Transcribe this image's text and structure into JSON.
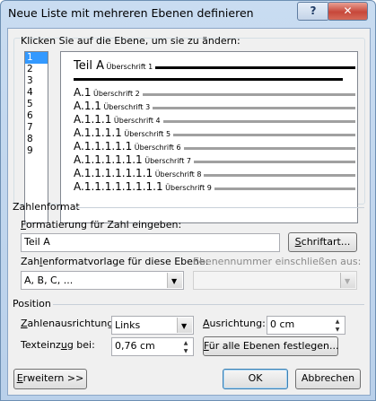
{
  "window": {
    "title": "Neue Liste mit mehreren Ebenen definieren",
    "help_label": "?",
    "close_label": "✕"
  },
  "level_section": {
    "instruction": "Klicken Sie auf die Ebene, um sie zu ändern:",
    "levels": [
      "1",
      "2",
      "3",
      "4",
      "5",
      "6",
      "7",
      "8",
      "9"
    ],
    "selected_level": "1"
  },
  "preview": {
    "rows": [
      {
        "num": "Teil A",
        "caption": "Überschrift 1"
      },
      {
        "num": "A.1",
        "caption": "Überschrift 2"
      },
      {
        "num": "A.1.1",
        "caption": "Überschrift 3"
      },
      {
        "num": "A.1.1.1",
        "caption": "Überschrift 4"
      },
      {
        "num": "A.1.1.1.1",
        "caption": "Überschrift 5"
      },
      {
        "num": "A.1.1.1.1.1",
        "caption": "Überschrift 6"
      },
      {
        "num": "A.1.1.1.1.1.1",
        "caption": "Überschrift 7"
      },
      {
        "num": "A.1.1.1.1.1.1.1",
        "caption": "Überschrift 8"
      },
      {
        "num": "A.1.1.1.1.1.1.1.1",
        "caption": "Überschrift 9"
      }
    ]
  },
  "zahlenformat": {
    "group_label": "Zahlenformat",
    "format_label": "Formatierung für Zahl eingeben:",
    "format_value": "Teil A",
    "font_button": "Schriftart...",
    "style_label": "Zahlenformatvorlage für diese Ebene:",
    "style_value": "A, B, C, ...",
    "include_label": "Ebenennummer einschließen aus:",
    "include_value": ""
  },
  "position": {
    "group_label": "Position",
    "align_label": "Zahlenausrichtung:",
    "align_value": "Links",
    "ausrichtung_label": "Ausrichtung:",
    "ausrichtung_value": "0 cm",
    "indent_label": "Texteinzug bei:",
    "indent_value": "0,76 cm",
    "all_levels_button": "Für alle Ebenen festlegen..."
  },
  "footer": {
    "expand_button": "Erweitern >>",
    "ok_button": "OK",
    "cancel_button": "Abbrechen"
  },
  "colors": {
    "selection": "#3399ff",
    "frame": "#6d8fb3"
  }
}
